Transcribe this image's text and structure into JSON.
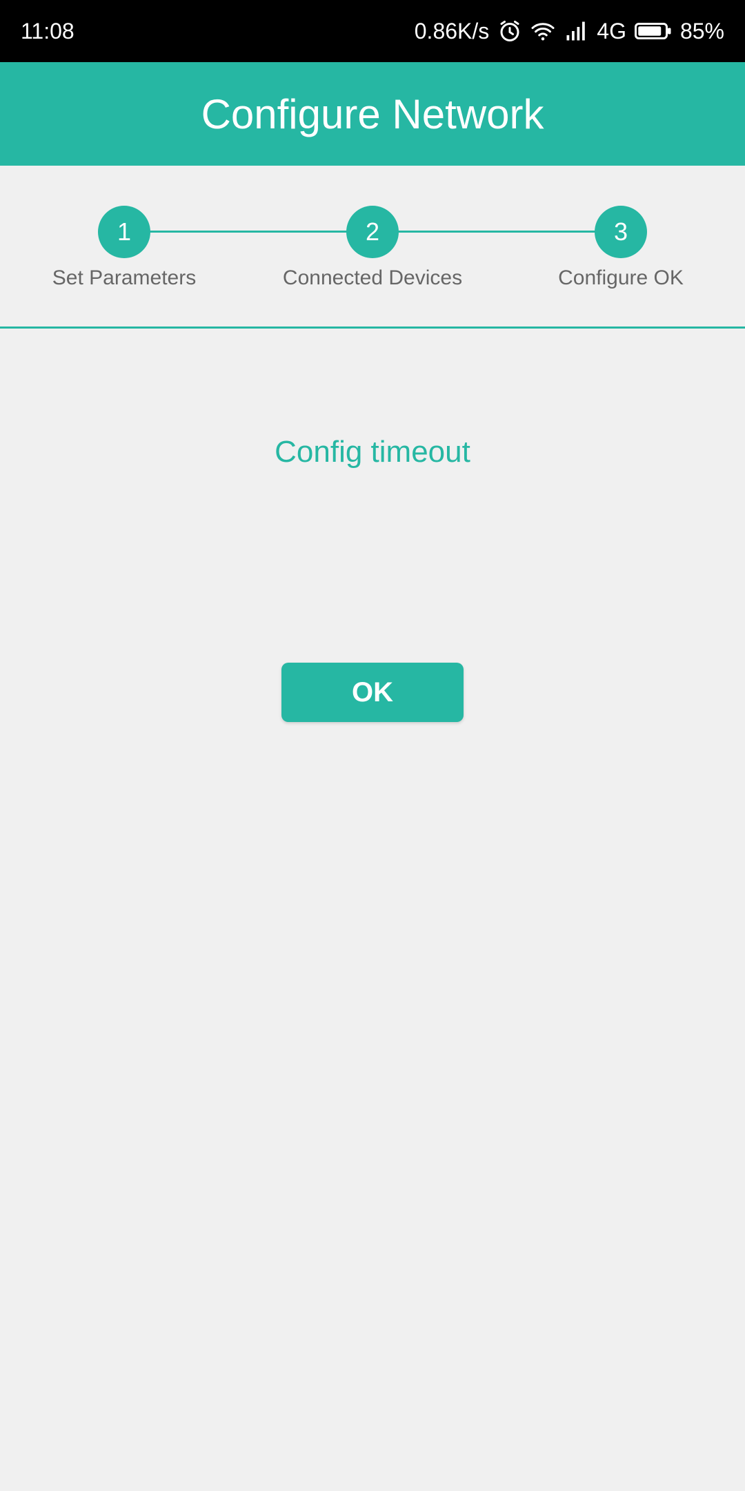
{
  "status_bar": {
    "time": "11:08",
    "net_speed": "0.86K/s",
    "network_type": "4G",
    "battery_percent": "85%",
    "icons": [
      "alarm-icon",
      "wifi-icon",
      "signal-icon",
      "battery-icon"
    ]
  },
  "app_bar": {
    "title": "Configure Network"
  },
  "stepper": {
    "steps": [
      {
        "number": "1",
        "label": "Set Parameters"
      },
      {
        "number": "2",
        "label": "Connected Devices"
      },
      {
        "number": "3",
        "label": "Configure OK"
      }
    ]
  },
  "content": {
    "message": "Config timeout",
    "ok_label": "OK"
  },
  "colors": {
    "accent": "#26b7a3",
    "background": "#f0f0f0",
    "label_gray": "#666666",
    "status_bar": "#000000"
  }
}
